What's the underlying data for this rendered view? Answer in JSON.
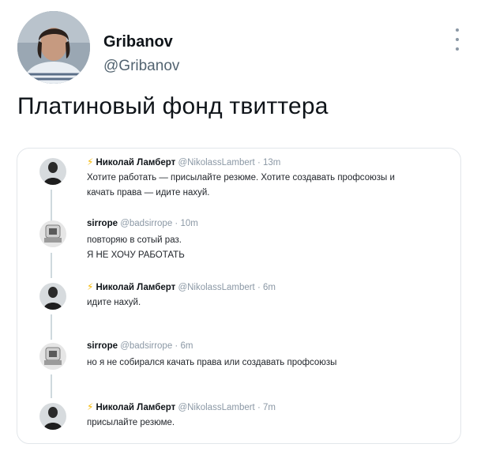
{
  "author": {
    "name": "Gribanov",
    "handle": "@Gribanov"
  },
  "tweet": {
    "text": "Платиновый фонд твиттера"
  },
  "thread": [
    {
      "name": "Николай Ламберт",
      "bolt": "⚡",
      "handle": "@NikolassLambert",
      "time": "· 13m",
      "lines": [
        "Хотите работать — присылайте резюме. Хотите создавать профсоюзы и",
        "качать права — идите нахуй."
      ]
    },
    {
      "name": "sirrope",
      "handle": "@badsirrope",
      "time": "· 10m",
      "lines": [
        "повторяю в сотый раз.",
        "Я НЕ ХОЧУ РАБОТАТЬ"
      ]
    },
    {
      "name": "Николай Ламберт",
      "bolt": "⚡",
      "handle": "@NikolassLambert",
      "time": "· 6m",
      "lines": [
        "идите нахуй."
      ]
    },
    {
      "name": "sirrope",
      "handle": "@badsirrope",
      "time": "· 6m",
      "lines": [
        "но я не собирался качать права или создавать профсоюзы"
      ]
    },
    {
      "name": "Николай Ламберт",
      "bolt": "⚡",
      "handle": "@NikolassLambert",
      "time": "· 7m",
      "lines": [
        "присылайте резюме."
      ]
    }
  ],
  "colors": {
    "text": "#0f1419",
    "secondary": "#536471",
    "bolt": "#f5b700",
    "border": "#e2e6ea"
  }
}
